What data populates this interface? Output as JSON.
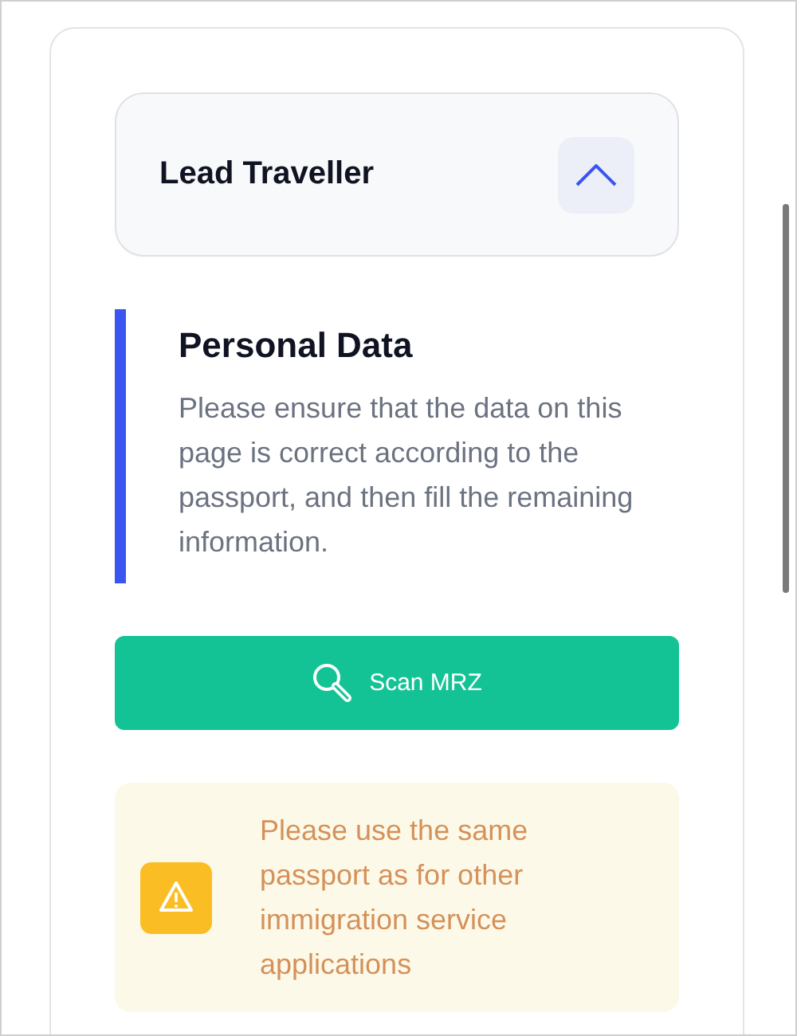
{
  "accordion": {
    "title": "Lead Traveller",
    "expanded": true
  },
  "section": {
    "title": "Personal Data",
    "description": "Please ensure that the data on this page is correct according to the passport, and then fill the remaining information."
  },
  "scan_button": {
    "label": "Scan MRZ"
  },
  "warning": {
    "text": "Please use the same passport as for other immigration service applications"
  }
}
